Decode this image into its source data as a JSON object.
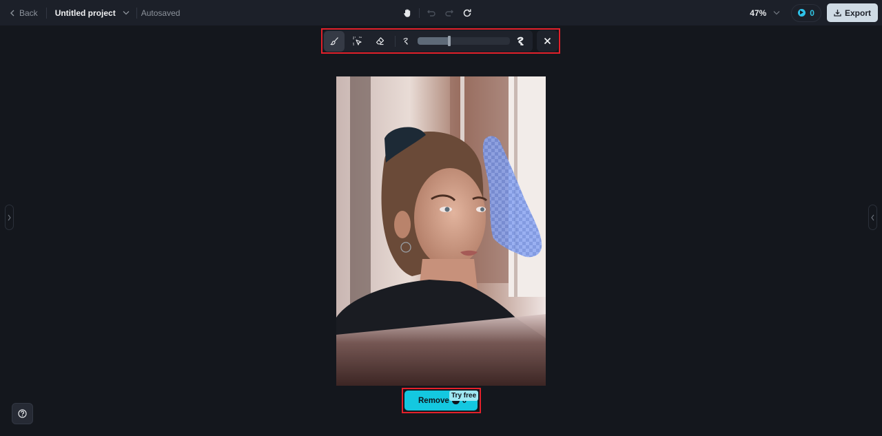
{
  "header": {
    "back_label": "Back",
    "project_title": "Untitled project",
    "save_status": "Autosaved",
    "zoom_level": "47%",
    "credits": "0",
    "export_label": "Export",
    "icons": {
      "back": "chevron-left-icon",
      "project_menu": "chevron-down-icon",
      "pan": "hand-icon",
      "undo": "undo-icon",
      "redo": "redo-icon",
      "reset": "refresh-icon",
      "zoom_menu": "chevron-down-icon",
      "credits": "credit-coin-icon",
      "export": "download-icon"
    }
  },
  "brush_toolbar": {
    "tools": [
      {
        "name": "brush",
        "icon": "brush-icon",
        "active": true
      },
      {
        "name": "select",
        "icon": "smart-select-icon",
        "active": false
      },
      {
        "name": "eraser",
        "icon": "eraser-icon",
        "active": false
      }
    ],
    "brush_size_percent": 34,
    "size_min_icon": "brush-size-small-icon",
    "size_max_icon": "brush-size-large-icon",
    "close_icon": "close-icon"
  },
  "canvas": {
    "image_description": "Portrait of a young woman looking out a window, with a blue checkered brush mask painted near the window"
  },
  "action": {
    "remove_label": "Remove",
    "remove_cost": "0",
    "badge": "Try free"
  },
  "colors": {
    "accent": "#14c8e0",
    "highlight_border": "#e3212b",
    "background": "#14171d",
    "topbar": "#1c2029",
    "mask": "#7d9cf0"
  }
}
